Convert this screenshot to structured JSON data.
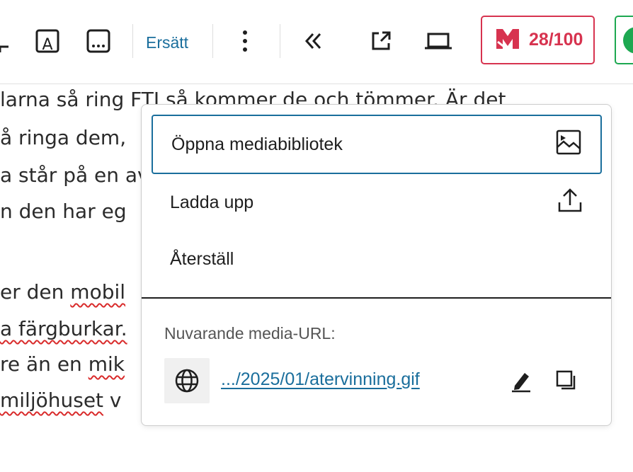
{
  "toolbar": {
    "replace_label": "Ersätt",
    "score": "28/100",
    "icons": [
      "crop-icon",
      "text-overlay-icon",
      "more-horizontal-box-icon",
      "more-vertical-icon",
      "collapse-double-chevron-icon",
      "open-external-icon",
      "laptop-preview-icon",
      "yoast-seo-icon",
      "green-plugin-icon"
    ]
  },
  "background_text": {
    "lines": [
      {
        "pre": "larna så ring FTI så kommer de och tömmer. Är det",
        "err": ""
      },
      {
        "pre": "å ringa dem,",
        "err": ""
      },
      {
        "pre": "a står på en av",
        "err": ""
      },
      {
        "pre": "n den har eg",
        "err": ""
      },
      {
        "pre": "er den ",
        "err": "mobil"
      },
      {
        "pre": "",
        "err": "a färgburkar."
      },
      {
        "pre": "re än en ",
        "err": "mik"
      },
      {
        "pre": "",
        "err": "miljöhuset",
        "post": " v"
      }
    ]
  },
  "popover": {
    "items": [
      {
        "label": "Öppna mediabibliotek",
        "icon": "image-icon"
      },
      {
        "label": "Ladda upp",
        "icon": "upload-icon"
      },
      {
        "label": "Återställ",
        "icon": ""
      }
    ],
    "current_url_label": "Nuvarande media-URL:",
    "current_url": ".../2025/01/atervinning.gif",
    "actions": [
      "edit-pencil-icon",
      "copy-icon"
    ]
  },
  "colors": {
    "accent": "#1a6e9c",
    "yoast": "#d7334f",
    "green": "#1da851",
    "spell_error": "#d92b2b"
  }
}
